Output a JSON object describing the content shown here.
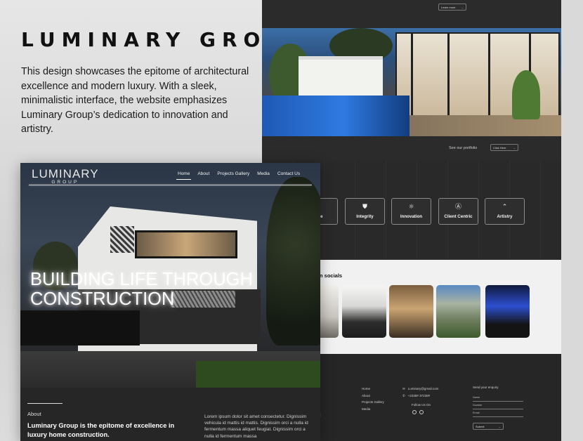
{
  "showcase": {
    "title": "LUMINARY GROUP",
    "description": "This design showcases the epitome of architectural excellence and modern luxury. With a sleek, minimalistic interface, the website emphasizes Luminary Group’s dedication to innovation and artistry."
  },
  "site": {
    "logo_main": "LUMINARY",
    "logo_sub": "GROUP",
    "nav": [
      {
        "label": "Home",
        "active": true
      },
      {
        "label": "About",
        "active": false
      },
      {
        "label": "Projects Gallery",
        "active": false
      },
      {
        "label": "Media",
        "active": false
      },
      {
        "label": "Contact Us",
        "active": false
      }
    ],
    "headline": "BUILDING LIFE THROUGH CONSTRUCTION",
    "about_label": "About",
    "about_heading": "Luminary Group is the epitome of excellence in luxury home construction.",
    "about_body": "Lorem ipsum dolor sit amet consectetur. Dignissim vehicula id mattis id mattis. Dignissim orci a nulla id fermentum massa aliquet feugiat. Dignissim orci a nulla id fermentum massa"
  },
  "second_page": {
    "top_button": "Learn more",
    "portfolio_label": "See our portfolio",
    "portfolio_button": "Click Here",
    "values": [
      {
        "label": "ence",
        "icon": "none"
      },
      {
        "label": "Integrity",
        "icon": "shield-icon",
        "glyph": "⛊"
      },
      {
        "label": "Innovation",
        "icon": "lightbulb-icon",
        "glyph": "☼"
      },
      {
        "label": "Client Centric",
        "icon": "person-icon",
        "glyph": "Ⓐ"
      },
      {
        "label": "Artistry",
        "icon": "chevron-up-icon",
        "glyph": "⌃"
      }
    ],
    "socials_title": "n socials",
    "footer": {
      "links": [
        "Home",
        "About",
        "Projects Gallery",
        "Media"
      ],
      "email": "Luminary@gmail.com",
      "phone": "+2338# 37238#",
      "follow": "Follow Us On",
      "enquiry": "Send your enquiry",
      "fields": [
        "Name",
        "Number",
        "Email"
      ],
      "submit": "Submit"
    }
  },
  "colors": {
    "dark": "#2b2b2b",
    "light_band": "#f1f1f1",
    "pool_blue": "#2f7ae1"
  }
}
